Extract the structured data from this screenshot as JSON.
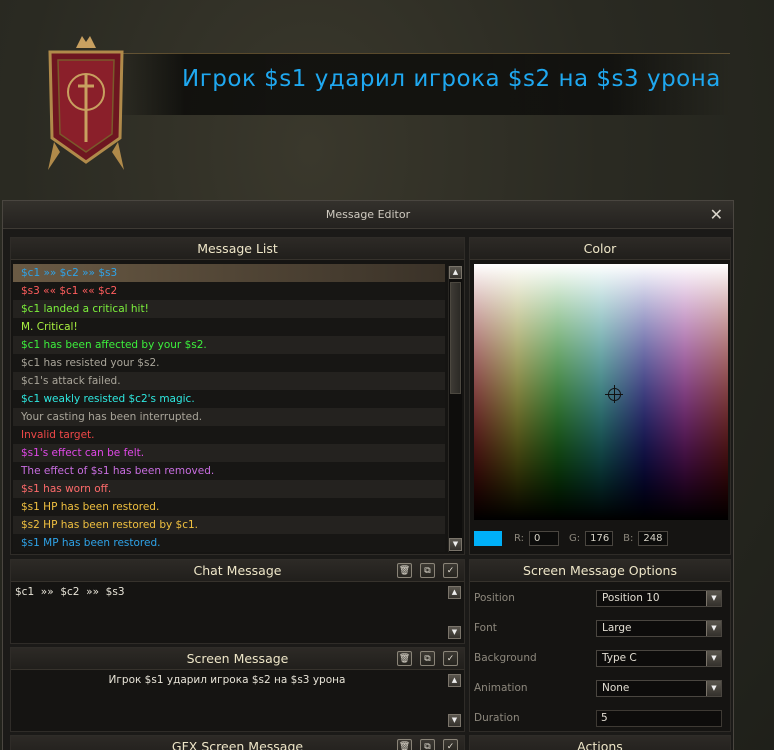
{
  "screen_banner": {
    "text": "Игрок $s1 ударил игрока $s2 на $s3 урона"
  },
  "window": {
    "title": "Message Editor",
    "close": "✕"
  },
  "message_list": {
    "title": "Message List",
    "rows": [
      {
        "text": "$c1  »»  $c2  »»  $s3",
        "color": "#2fa3e8"
      },
      {
        "text": "$s3  ««  $c1  ««  $c2",
        "color": "#ff5d5d"
      },
      {
        "text": "$c1 landed a critical hit!",
        "color": "#7cf03c"
      },
      {
        "text": "M. Critical!",
        "color": "#a8f040"
      },
      {
        "text": "$c1 has been affected by your $s2.",
        "color": "#3cf03c"
      },
      {
        "text": "$c1 has resisted your $s2.",
        "color": "#a9a59a"
      },
      {
        "text": "$c1's attack failed.",
        "color": "#a9a59a"
      },
      {
        "text": "$c1 weakly resisted $c2's magic.",
        "color": "#2ee8e0"
      },
      {
        "text": "Your casting has been interrupted.",
        "color": "#a9a59a"
      },
      {
        "text": "Invalid target.",
        "color": "#f04848"
      },
      {
        "text": "$s1's effect can be felt.",
        "color": "#e048e8"
      },
      {
        "text": "The effect of $s1 has been removed.",
        "color": "#c86ee0"
      },
      {
        "text": "$s1 has worn off.",
        "color": "#ff6b6b"
      },
      {
        "text": "$s1 HP has been restored.",
        "color": "#f0c040"
      },
      {
        "text": "$s2 HP has been restored by $c1.",
        "color": "#f0c040"
      },
      {
        "text": "$s1 MP has been restored.",
        "color": "#2fa3e8"
      }
    ]
  },
  "color_panel": {
    "title": "Color",
    "r_label": "R:",
    "r": "0",
    "g_label": "G:",
    "g": "176",
    "b_label": "B:",
    "b": "248",
    "swatch_color": "#00b0f8"
  },
  "chat_message": {
    "title": "Chat Message",
    "text": "$c1  »»  $c2  »»  $s3"
  },
  "screen_message": {
    "title": "Screen Message",
    "text": "Игрок $s1 ударил игрока $s2 на $s3 урона"
  },
  "gfx_screen_message": {
    "title": "GFX Screen Message"
  },
  "screen_options": {
    "title": "Screen Message Options",
    "position_label": "Position",
    "position_value": "Position 10",
    "font_label": "Font",
    "font_value": "Large",
    "background_label": "Background",
    "background_value": "Type C",
    "animation_label": "Animation",
    "animation_value": "None",
    "duration_label": "Duration",
    "duration_value": "5"
  },
  "actions": {
    "title": "Actions"
  }
}
